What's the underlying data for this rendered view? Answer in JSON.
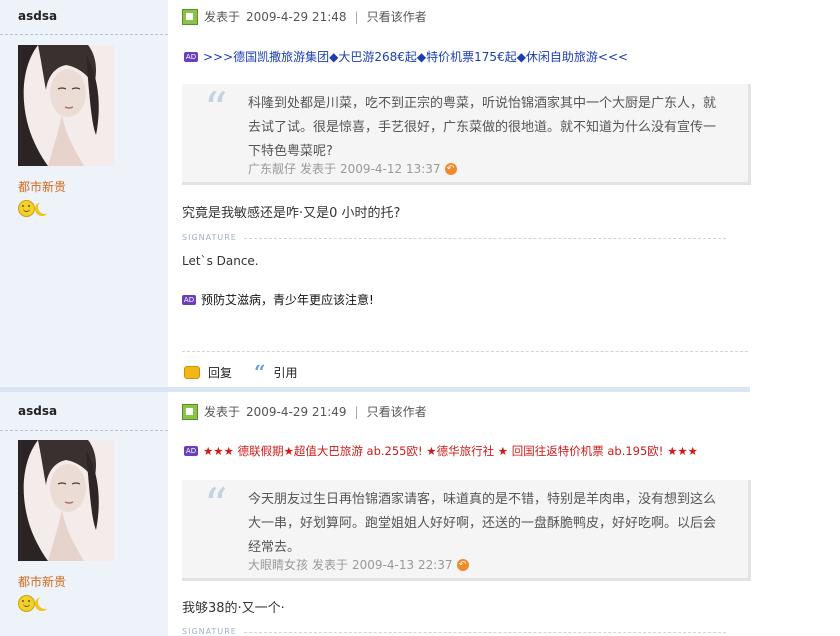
{
  "posts": [
    {
      "author": "asdsa",
      "rank": "都市新贵",
      "posted_prefix": "发表于",
      "posted_time": "2009-4-29 21:48",
      "only_author": "只看该作者",
      "ad_text": ">>>德国凯撒旅游集团◆大巴游268€起◆特价机票175€起◆休闲自助旅游<<<",
      "ad_color": "#1a3fb5",
      "quote_text": "科隆到处都是川菜，吃不到正宗的粤菜，听说怡锦酒家其中一个大厨是广东人，就去试了试。很是惊喜，手艺很好，广东菜做的很地道。就不知道为什么没有宣传一下特色粤菜呢?",
      "quote_author": "广东靓仔",
      "quote_prefix": "发表于",
      "quote_time": "2009-4-12 13:37",
      "body": "究竟是我敏感还是咋·又是0 小时的托?",
      "signature_label": "SIGNATURE",
      "signature": "Let`s Dance.",
      "ad2_text": "预防艾滋病，青少年更应该注意!",
      "reply_label": "回复",
      "cite_label": "引用"
    },
    {
      "author": "asdsa",
      "rank": "都市新贵",
      "posted_prefix": "发表于",
      "posted_time": "2009-4-29 21:49",
      "only_author": "只看该作者",
      "ad_text": "★★★ 德联假期★超值大巴旅游 ab.255欧! ★德华旅行社 ★ 回国往返特价机票 ab.195欧! ★★★",
      "ad_color": "#d01a1a",
      "quote_text": "今天朋友过生日再怡锦酒家请客，味道真的是不错，特别是羊肉串，没有想到这么大一串，好划算阿。跑堂姐姐人好好啊，还送的一盘酥脆鸭皮，好好吃啊。以后会经常去。",
      "quote_author": "大眼睛女孩",
      "quote_prefix": "发表于",
      "quote_time": "2009-4-13 22:37",
      "body": "我够38的·又一个·",
      "signature_label": "SIGNATURE"
    }
  ],
  "icons": {
    "post": "post-icon",
    "ad": "ad-badge-icon",
    "back": "back-arrow-icon",
    "reply": "reply-icon",
    "cite": "quote-icon",
    "medal1": "smiley-medal-icon",
    "medal2": "moon-medal-icon"
  }
}
